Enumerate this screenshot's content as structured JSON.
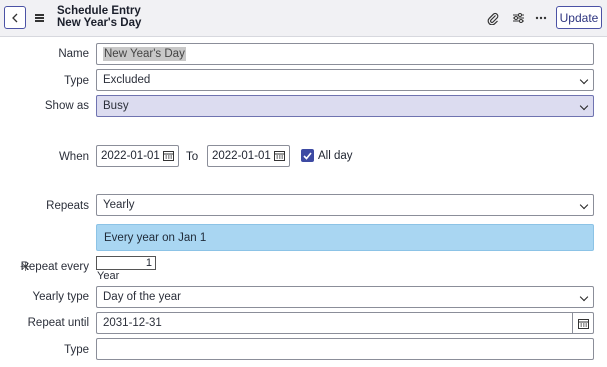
{
  "header": {
    "title": "Schedule Entry",
    "subtitle": "New Year's Day",
    "back_icon": "chevron-left-icon",
    "menu_icon": "hamburger-icon",
    "attachment_icon": "paperclip-icon",
    "settings_icon": "sliders-icon",
    "more_icon": "ellipsis-icon",
    "update_label": "Update"
  },
  "form": {
    "name": {
      "label": "Name",
      "value": "New Year's Day"
    },
    "type": {
      "label": "Type",
      "value": "Excluded"
    },
    "show_as": {
      "label": "Show as",
      "value": "Busy"
    },
    "when": {
      "label": "When",
      "from": "2022-01-01",
      "to_label": "To",
      "to": "2022-01-01",
      "all_day_label": "All day",
      "all_day": true
    },
    "repeats": {
      "label": "Repeats",
      "value": "Yearly"
    },
    "summary": "Every year on Jan 1",
    "repeat_every": {
      "label": "Repeat every",
      "value": "1",
      "unit": "Year",
      "required_marker": "✳"
    },
    "yearly_type": {
      "label": "Yearly type",
      "value": "Day of the year"
    },
    "repeat_until": {
      "label": "Repeat until",
      "value": "2031-12-31"
    },
    "type2": {
      "label": "Type",
      "value": ""
    }
  },
  "colors": {
    "accent": "#4b52a5",
    "selected_bg": "#dcdcf0",
    "info_bg": "#a9d6f2"
  }
}
